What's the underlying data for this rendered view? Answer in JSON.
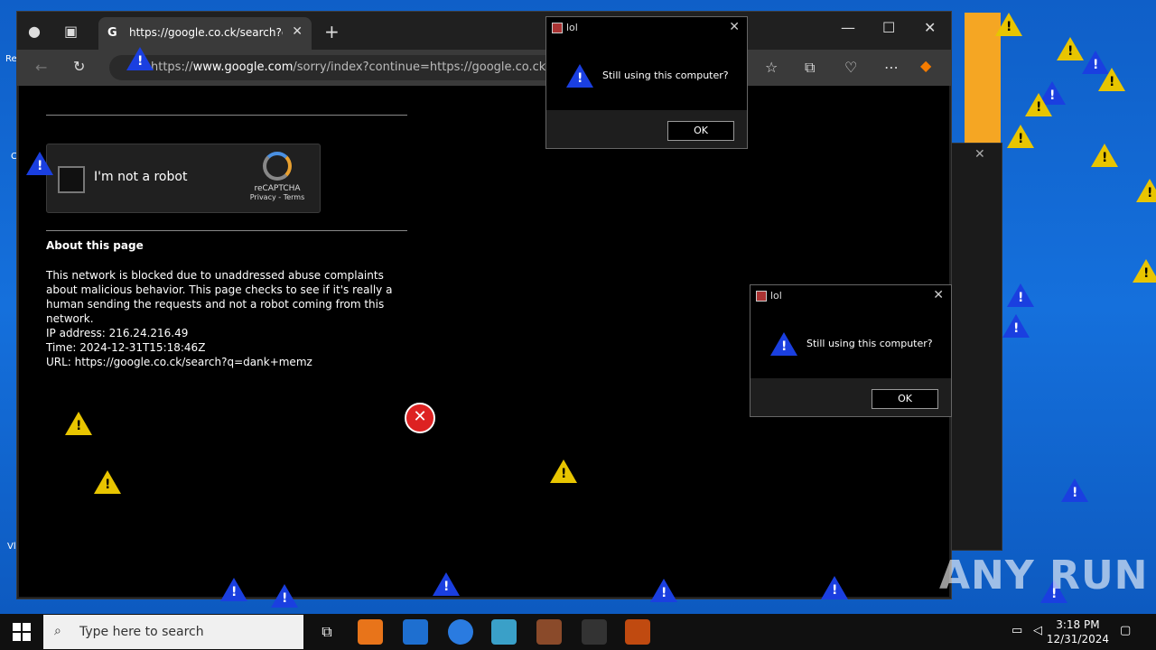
{
  "desktop": {
    "side_labels": [
      "Re",
      "C",
      "Vl"
    ]
  },
  "browser": {
    "tab": {
      "title": "https://google.co.ck/search?q=d"
    },
    "address": {
      "prefix": "https://",
      "domain": "www.google.com",
      "rest": "/sorry/index?continue=https://google.co.ck/sear"
    }
  },
  "page": {
    "captcha": {
      "checkbox_label": "I'm not a robot",
      "brand": "reCAPTCHA",
      "links": "Privacy - Terms"
    },
    "about_title": "About this page",
    "about_body": "This network is blocked due to unaddressed abuse complaints about malicious behavior. This page checks to see if it's really a human sending the requests and not a robot coming from this network.",
    "ip_line": "IP address: 216.24.216.49",
    "time_line": "Time: 2024-12-31T15:18:46Z",
    "url_line": "URL: https://google.co.ck/search?q=dank+memz"
  },
  "dialogs": [
    {
      "title": "lol",
      "message": "Still using this computer?",
      "ok_label": "OK"
    },
    {
      "title": "lol",
      "message": "Still using this computer?",
      "ok_label": "OK"
    }
  ],
  "taskbar": {
    "search_placeholder": "Type here to search",
    "time": "3:18 PM",
    "date": "12/31/2024"
  },
  "watermark": "ANY RUN",
  "colors": {
    "desktop_blue": "#1570dc",
    "warning_yellow": "#e8c500",
    "warning_blue": "#1a3fe0"
  }
}
